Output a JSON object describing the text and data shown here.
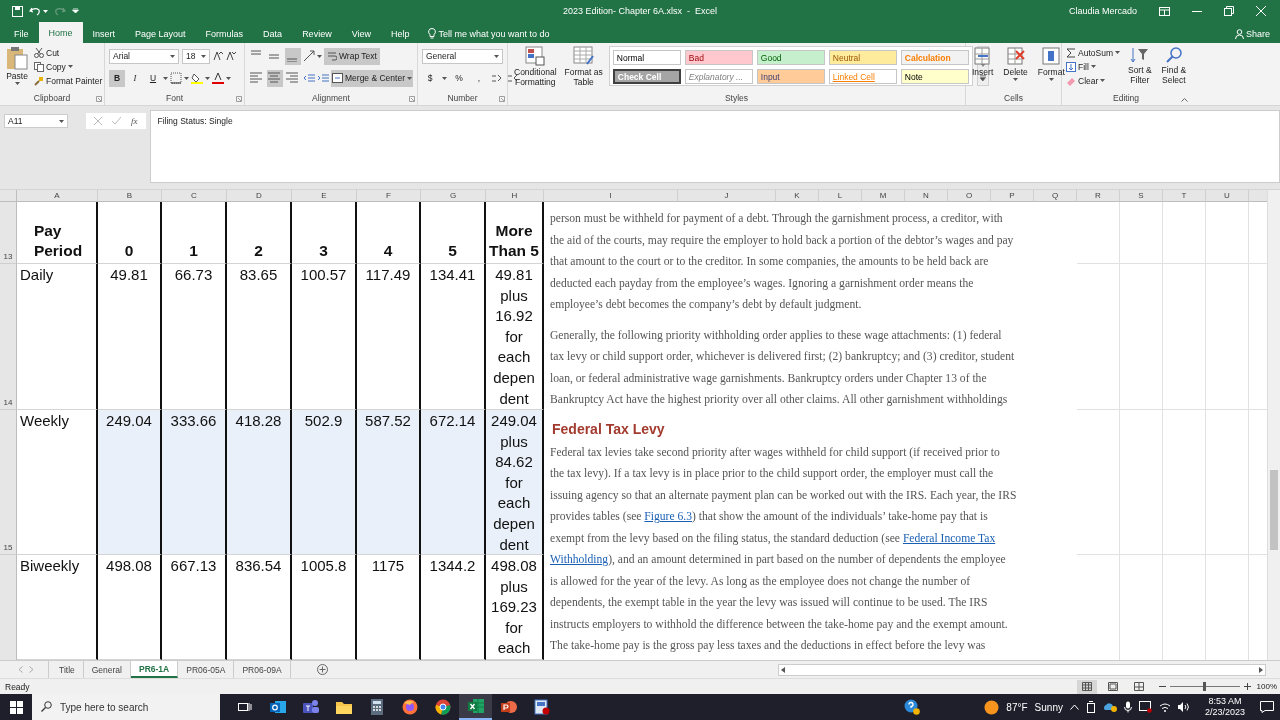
{
  "title_bar": {
    "title": "2023 Edition- Chapter 6A.xlsx  -  Excel",
    "user": "Claudia Mercado"
  },
  "ribbon_tabs": [
    {
      "label": "File",
      "selected": false
    },
    {
      "label": "Home",
      "selected": true
    },
    {
      "label": "Insert",
      "selected": false
    },
    {
      "label": "Page Layout",
      "selected": false
    },
    {
      "label": "Formulas",
      "selected": false
    },
    {
      "label": "Data",
      "selected": false
    },
    {
      "label": "Review",
      "selected": false
    },
    {
      "label": "View",
      "selected": false
    },
    {
      "label": "Help",
      "selected": false
    }
  ],
  "tell_me": "Tell me what you want to do",
  "share": "Share",
  "clipboard": {
    "paste": "Paste",
    "cut": "Cut",
    "copy": "Copy",
    "format_painter": "Format Painter",
    "label": "Clipboard"
  },
  "font": {
    "name": "Arial",
    "size": "18",
    "styles": [
      {
        "label": "B",
        "selected": true
      },
      {
        "label": "I",
        "selected": false
      },
      {
        "label": "U",
        "selected": false
      }
    ],
    "label": "Font"
  },
  "alignment": {
    "vertical": [
      {
        "selected": false
      },
      {
        "selected": false
      },
      {
        "selected": true
      }
    ],
    "horizontal": [
      {
        "selected": false
      },
      {
        "selected": true
      },
      {
        "selected": false
      }
    ],
    "wrap_text": {
      "label": "Wrap Text",
      "selected": true
    },
    "merge": {
      "label": "Merge & Center",
      "selected": true
    },
    "label": "Alignment"
  },
  "number": {
    "format": "General",
    "currency": "$",
    "percent": "%",
    "comma": ",",
    "label": "Number"
  },
  "styles": {
    "conditional": [
      "Conditional",
      "Formatting"
    ],
    "format_table": [
      "Format as",
      "Table"
    ],
    "gallery": [
      {
        "label": "Normal",
        "kind": "normal",
        "color": "#ffffff"
      },
      {
        "label": "Bad",
        "kind": "bad",
        "color": "#ffc7ce"
      },
      {
        "label": "Good",
        "kind": "good",
        "color": "#c6efce"
      },
      {
        "label": "Neutral",
        "kind": "neutral",
        "color": "#ffeb9c"
      },
      {
        "label": "Calculation",
        "kind": "calculation",
        "color": "#f2f2f2"
      },
      {
        "label": "Check Cell",
        "kind": "check",
        "color": "#a5a5a5"
      },
      {
        "label": "Explanatory ...",
        "kind": "explanatory",
        "color": "#ffffff"
      },
      {
        "label": "Input",
        "kind": "input",
        "color": "#ffcc99"
      },
      {
        "label": "Linked Cell",
        "kind": "linked",
        "color": "#ffffff"
      },
      {
        "label": "Note",
        "kind": "note",
        "color": "#ffffcc"
      }
    ],
    "label": "Styles"
  },
  "cells": {
    "buttons": [
      "Insert",
      "Delete",
      "Format"
    ],
    "label": "Cells"
  },
  "editing": {
    "autosum": "AutoSum",
    "fill": "Fill",
    "clear": "Clear",
    "sort": [
      "Sort &",
      "Filter"
    ],
    "find": [
      "Find &",
      "Select"
    ],
    "label": "Editing"
  },
  "formula_bar": {
    "name_box": "A11",
    "fx": "fx",
    "formula": "Filing Status: Single"
  },
  "columns": [
    "A",
    "B",
    "C",
    "D",
    "E",
    "F",
    "G",
    "H",
    "I",
    "J",
    "K",
    "L",
    "M",
    "N",
    "O",
    "P",
    "Q",
    "R",
    "S",
    "T",
    "U"
  ],
  "table": {
    "rows": [
      {
        "number": "13",
        "kind": "header",
        "shaded": false,
        "cells": [
          [
            "Pay",
            "Period"
          ],
          "0",
          "1",
          "2",
          "3",
          "4",
          "5",
          [
            "More",
            "Than 5"
          ]
        ]
      },
      {
        "number": "14",
        "kind": "data",
        "shaded": false,
        "cells": [
          "Daily",
          "49.81",
          "66.73",
          "83.65",
          "100.57",
          "117.49",
          "134.41",
          [
            "49.81",
            "plus",
            "16.92",
            "for",
            "each",
            "depen",
            "dent"
          ]
        ]
      },
      {
        "number": "15",
        "kind": "data",
        "shaded": true,
        "cells": [
          "Weekly",
          "249.04",
          "333.66",
          "418.28",
          "502.9",
          "587.52",
          "672.14",
          [
            "249.04",
            "plus",
            "84.62",
            "for",
            "each",
            "depen",
            "dent"
          ]
        ]
      },
      {
        "kind": "data",
        "shaded": false,
        "cells": [
          "Biweekly",
          "498.08",
          "667.13",
          "836.54",
          "1005.8",
          "1175",
          "1344.2",
          [
            "498.08",
            "plus",
            "169.23",
            "for",
            "each"
          ]
        ]
      }
    ]
  },
  "document": {
    "blocks": [
      {
        "kind": "paragraph",
        "lines": [
          "person must be withheld for payment of a debt. Through the garnishment process, a creditor, with",
          "the aid of the courts, may require the employer to hold back a portion of the debtor’s wages and pay",
          "that amount to the court or to the creditor. In some companies, the amounts to be held back are",
          "deducted each payday from the employee’s wages. Ignoring a garnishment order means the",
          "employee’s debt becomes the company’s debt by default judgment."
        ]
      },
      {
        "kind": "paragraph",
        "lines": [
          "Generally, the following priority withholding order applies to these wage attachments: (1) federal",
          "tax levy or child support order, whichever is delivered first; (2) bankruptcy; and (3) creditor, student",
          "loan, or federal administrative wage garnishments. Bankruptcy orders under Chapter 13 of the",
          "Bankruptcy Act have the highest priority over all other claims. All other garnishment withholdings"
        ]
      },
      {
        "kind": "heading",
        "text": "Federal Tax Levy"
      },
      {
        "kind": "paragraph",
        "lines": [
          "Federal tax levies take second priority after wages withheld for child support (if received prior to",
          "the tax levy). If a tax levy is in place prior to the child support order, the employer must call the",
          "issuing agency so that an alternate payment plan can be worked out with the IRS. Each year, the IRS",
          [
            {
              "text": "provides tables (see ",
              "link": false
            },
            {
              "text": "Figure 6.3",
              "link": true
            },
            {
              "text": ") that show the amount of the individuals’ take-home pay that is",
              "link": false
            }
          ],
          [
            {
              "text": "exempt from the levy based on the filing status, the standard deduction (see ",
              "link": false
            },
            {
              "text": "Federal Income Tax",
              "link": true
            }
          ],
          [
            {
              "text": "Withholding",
              "link": true
            },
            {
              "text": "), and an amount determined in part based on the number of dependents the employee",
              "link": false
            }
          ],
          "is allowed for the year of the levy. As long as the employee does not change the number of",
          "dependents, the exempt table in the year the levy was issued will continue to be used. The IRS",
          "instructs employers to withhold the difference between the take-home pay and the exempt amount.",
          "The take-home pay is the gross pay less taxes and the deductions in effect before the levy was"
        ]
      }
    ]
  },
  "sheet_tabs": [
    {
      "label": "Title",
      "selected": false
    },
    {
      "label": "General",
      "selected": false
    },
    {
      "label": "PR6-1A",
      "selected": true
    },
    {
      "label": "PR06-05A",
      "selected": false
    },
    {
      "label": "PR06-09A",
      "selected": false
    }
  ],
  "status_bar": {
    "mode": "Ready",
    "views": [
      {
        "selected": true
      },
      {
        "selected": false
      },
      {
        "selected": false
      }
    ],
    "zoom": {
      "level": 0.5
    },
    "zoom_label": "100%"
  },
  "taskbar": {
    "search_placeholder": "Type here to search",
    "apps": [
      {
        "kind": "mail",
        "selected": false
      },
      {
        "kind": "chat",
        "selected": false
      },
      {
        "kind": "folder",
        "selected": false
      },
      {
        "kind": "calculator",
        "selected": false
      },
      {
        "kind": "browser_orange",
        "selected": false
      },
      {
        "kind": "browser_round",
        "selected": false
      },
      {
        "kind": "spreadsheet",
        "selected": true
      },
      {
        "kind": "presentation",
        "selected": false
      },
      {
        "kind": "app",
        "selected": false
      }
    ],
    "temperature": "87°F",
    "weather": "Sunny",
    "time": "8:53 AM",
    "date": "2/23/2023"
  }
}
